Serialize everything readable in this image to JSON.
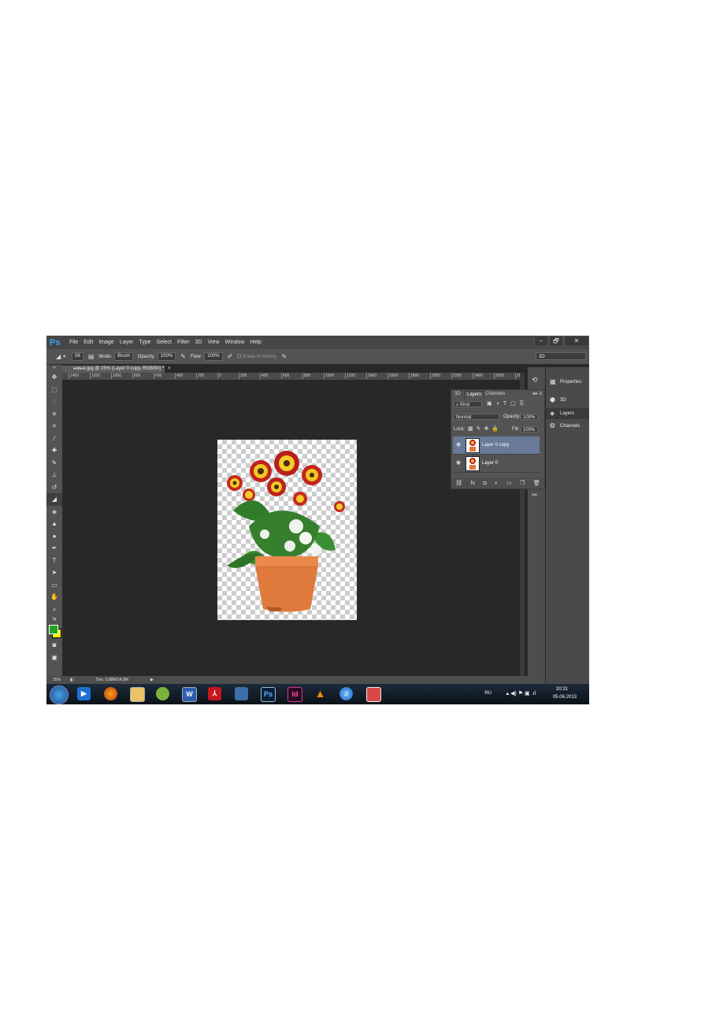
{
  "app": {
    "logo": "Ps",
    "menu": [
      "File",
      "Edit",
      "Image",
      "Layer",
      "Type",
      "Select",
      "Filter",
      "3D",
      "View",
      "Window",
      "Help"
    ],
    "window_controls": [
      "–",
      "🗗",
      "✕"
    ]
  },
  "options": {
    "brush_size": "58",
    "mode_label": "Mode:",
    "mode_value": "Brush",
    "opacity_label": "Opacity:",
    "opacity_value": "100%",
    "flow_label": "Flow:",
    "flow_value": "100%",
    "erase_history": "Erase to History",
    "workspace": "3D"
  },
  "document": {
    "tab_title": "ымын.jpg @ 25% (Layer 0 copy, RGB/8#) *",
    "tab_close": "×",
    "ruler_ticks": [
      "1400",
      "1200",
      "1000",
      "800",
      "600",
      "400",
      "200",
      "0",
      "200",
      "400",
      "600",
      "800",
      "1000",
      "1200",
      "1400",
      "1600",
      "1800",
      "2000",
      "2200",
      "2400",
      "2600",
      "28"
    ]
  },
  "layers_panel": {
    "tabs": [
      "3D",
      "Layers",
      "Channels"
    ],
    "filter_kind": "Kind",
    "blend_mode": "Normal",
    "opacity_label": "Opacity:",
    "opacity_value": "100%",
    "lock_label": "Lock:",
    "fill_label": "Fill:",
    "fill_value": "100%",
    "layers": [
      {
        "name": "Layer 0 copy",
        "selected": true
      },
      {
        "name": "Layer 0",
        "selected": false
      }
    ]
  },
  "dock": {
    "items": [
      {
        "label": "Properties",
        "icon": "properties-icon"
      },
      {
        "label": "3D",
        "icon": "3d-icon"
      },
      {
        "label": "Layers",
        "icon": "layers-icon"
      },
      {
        "label": "Channels",
        "icon": "channels-icon"
      }
    ]
  },
  "status": {
    "zoom": "25%",
    "doc_info": "Doc: 5,88M/14,9M"
  },
  "taskbar": {
    "apps": [
      "media-player",
      "firefox",
      "explorer",
      "app-green",
      "word",
      "acrobat",
      "app-flash",
      "photoshop",
      "indesign",
      "vlc",
      "itunes",
      "app-red"
    ],
    "app_labels": {
      "word": "W",
      "photoshop": "Ps",
      "indesign": "Id"
    },
    "lang": "RU",
    "time": "20:31",
    "date": "05.06.2013"
  },
  "colors": {
    "foreground": "#1fa51f",
    "background": "#f4f400",
    "selected_layer": "#687a98"
  }
}
